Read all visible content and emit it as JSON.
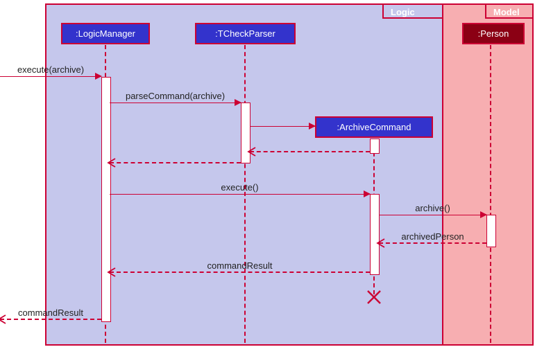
{
  "frames": {
    "logic": "Logic",
    "model": "Model"
  },
  "participants": {
    "logicManager": ":LogicManager",
    "tCheckParser": ":TCheckParser",
    "archiveCommand": ":ArchiveCommand",
    "person": ":Person"
  },
  "messages": {
    "execute_archive_in": "execute(archive)",
    "parseCommand": "parseCommand(archive)",
    "execute": "execute()",
    "archive": "archive()",
    "archivedPerson": "archivedPerson",
    "commandResult1": "commandResult",
    "commandResult2": "commandResult"
  },
  "chart_data": {
    "type": "sequence_diagram",
    "frames": [
      {
        "name": "Logic",
        "participants": [
          ":LogicManager",
          ":TCheckParser",
          ":ArchiveCommand"
        ]
      },
      {
        "name": "Model",
        "participants": [
          ":Person"
        ]
      }
    ],
    "participants": [
      ":LogicManager",
      ":TCheckParser",
      ":ArchiveCommand",
      ":Person"
    ],
    "messages": [
      {
        "from": "external",
        "to": ":LogicManager",
        "label": "execute(archive)",
        "type": "sync"
      },
      {
        "from": ":LogicManager",
        "to": ":TCheckParser",
        "label": "parseCommand(archive)",
        "type": "sync"
      },
      {
        "from": ":TCheckParser",
        "to": ":ArchiveCommand",
        "label": "",
        "type": "create"
      },
      {
        "from": ":ArchiveCommand",
        "to": ":TCheckParser",
        "label": "",
        "type": "return"
      },
      {
        "from": ":TCheckParser",
        "to": ":LogicManager",
        "label": "",
        "type": "return"
      },
      {
        "from": ":LogicManager",
        "to": ":ArchiveCommand",
        "label": "execute()",
        "type": "sync"
      },
      {
        "from": ":ArchiveCommand",
        "to": ":Person",
        "label": "archive()",
        "type": "sync"
      },
      {
        "from": ":Person",
        "to": ":ArchiveCommand",
        "label": "archivedPerson",
        "type": "return"
      },
      {
        "from": ":ArchiveCommand",
        "to": ":LogicManager",
        "label": "commandResult",
        "type": "return"
      },
      {
        "from": ":ArchiveCommand",
        "to": ":ArchiveCommand",
        "label": "",
        "type": "destroy"
      },
      {
        "from": ":LogicManager",
        "to": "external",
        "label": "commandResult",
        "type": "return"
      }
    ]
  }
}
